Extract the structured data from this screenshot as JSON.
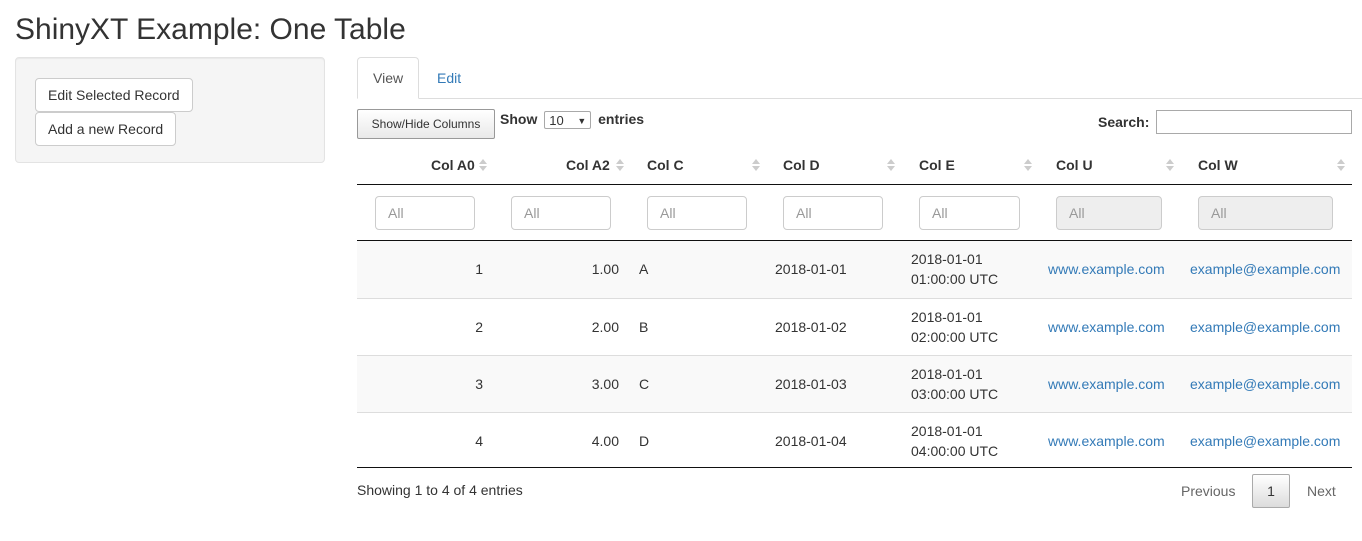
{
  "page": {
    "title": "ShinyXT Example: One Table"
  },
  "sidebar": {
    "edit_button": "Edit Selected Record",
    "add_button": "Add a new Record"
  },
  "tabs": [
    {
      "label": "View",
      "active": true
    },
    {
      "label": "Edit",
      "active": false
    }
  ],
  "table_controls": {
    "colvis_button": "Show/Hide Columns",
    "show_label": "Show",
    "entries_value": "10",
    "entries_label": "entries",
    "search_label": "Search:",
    "search_value": ""
  },
  "table": {
    "columns": [
      "Col A0",
      "Col A2",
      "Col C",
      "Col D",
      "Col E",
      "Col U",
      "Col W"
    ],
    "filters": [
      {
        "placeholder": "All",
        "disabled": false
      },
      {
        "placeholder": "All",
        "disabled": false
      },
      {
        "placeholder": "All",
        "disabled": false
      },
      {
        "placeholder": "All",
        "disabled": false
      },
      {
        "placeholder": "All",
        "disabled": false
      },
      {
        "placeholder": "All",
        "disabled": true
      },
      {
        "placeholder": "All",
        "disabled": true
      }
    ],
    "rows": [
      {
        "a0": "1",
        "a2": "1.00",
        "c": "A",
        "d": "2018-01-01",
        "e1": "2018-01-01",
        "e2": "01:00:00 UTC",
        "u": "www.example.com",
        "w": "example@example.com"
      },
      {
        "a0": "2",
        "a2": "2.00",
        "c": "B",
        "d": "2018-01-02",
        "e1": "2018-01-01",
        "e2": "02:00:00 UTC",
        "u": "www.example.com",
        "w": "example@example.com"
      },
      {
        "a0": "3",
        "a2": "3.00",
        "c": "C",
        "d": "2018-01-03",
        "e1": "2018-01-01",
        "e2": "03:00:00 UTC",
        "u": "www.example.com",
        "w": "example@example.com"
      },
      {
        "a0": "4",
        "a2": "4.00",
        "c": "D",
        "d": "2018-01-04",
        "e1": "2018-01-01",
        "e2": "04:00:00 UTC",
        "u": "www.example.com",
        "w": "example@example.com"
      }
    ]
  },
  "footer": {
    "info": "Showing 1 to 4 of 4 entries",
    "previous": "Previous",
    "current_page": "1",
    "next": "Next"
  },
  "colors": {
    "link": "#337ab7",
    "text": "#333333",
    "stripe": "#f9f9f9"
  }
}
